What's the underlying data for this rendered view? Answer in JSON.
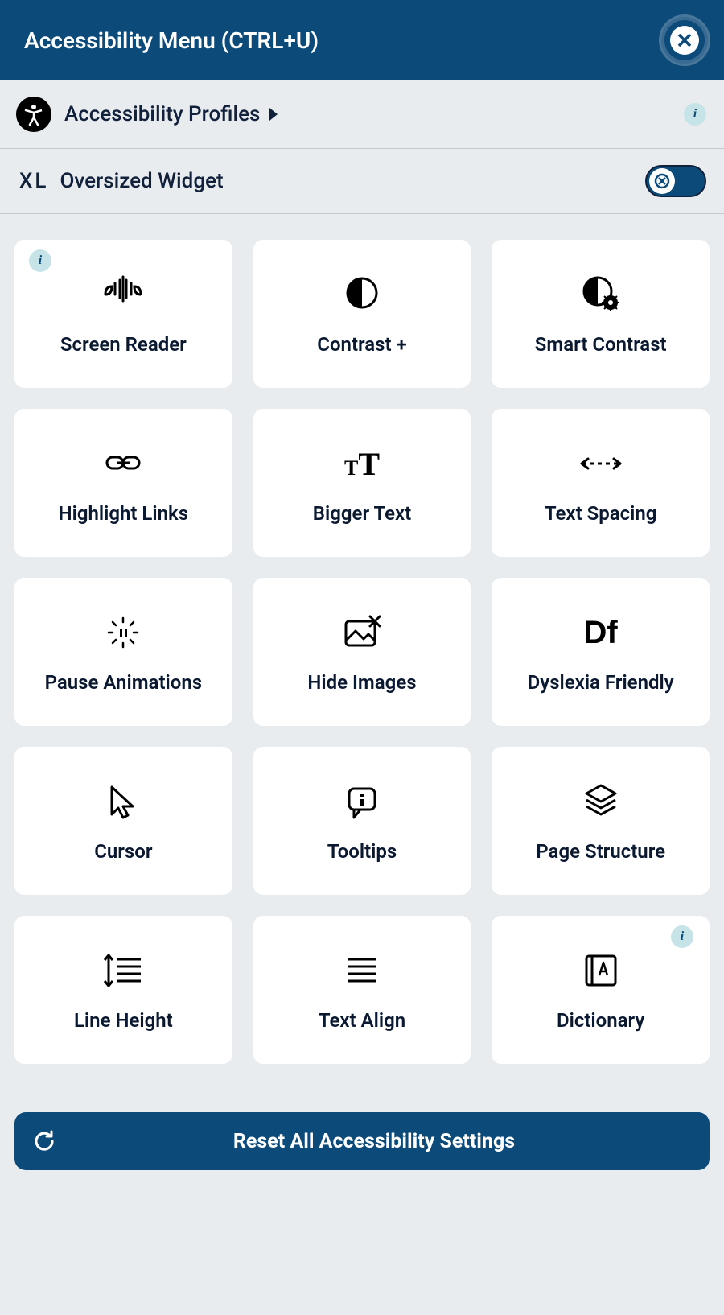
{
  "header": {
    "title": "Accessibility Menu (CTRL+U)"
  },
  "profiles": {
    "label": "Accessibility Profiles"
  },
  "oversized": {
    "icon_text": "XL",
    "label": "Oversized Widget",
    "toggle_on": false
  },
  "tiles": [
    {
      "label": "Screen Reader",
      "icon": "screen-reader",
      "info": "left"
    },
    {
      "label": "Contrast +",
      "icon": "contrast"
    },
    {
      "label": "Smart Contrast",
      "icon": "smart-contrast"
    },
    {
      "label": "Highlight Links",
      "icon": "link"
    },
    {
      "label": "Bigger Text",
      "icon": "bigger-text"
    },
    {
      "label": "Text Spacing",
      "icon": "text-spacing"
    },
    {
      "label": "Pause Animations",
      "icon": "pause"
    },
    {
      "label": "Hide Images",
      "icon": "hide-image"
    },
    {
      "label": "Dyslexia Friendly",
      "icon": "dyslexia"
    },
    {
      "label": "Cursor",
      "icon": "cursor"
    },
    {
      "label": "Tooltips",
      "icon": "tooltip"
    },
    {
      "label": "Page Structure",
      "icon": "layers"
    },
    {
      "label": "Line Height",
      "icon": "line-height"
    },
    {
      "label": "Text Align",
      "icon": "text-align"
    },
    {
      "label": "Dictionary",
      "icon": "dictionary",
      "info": "right"
    }
  ],
  "reset": {
    "label": "Reset All Accessibility Settings"
  }
}
